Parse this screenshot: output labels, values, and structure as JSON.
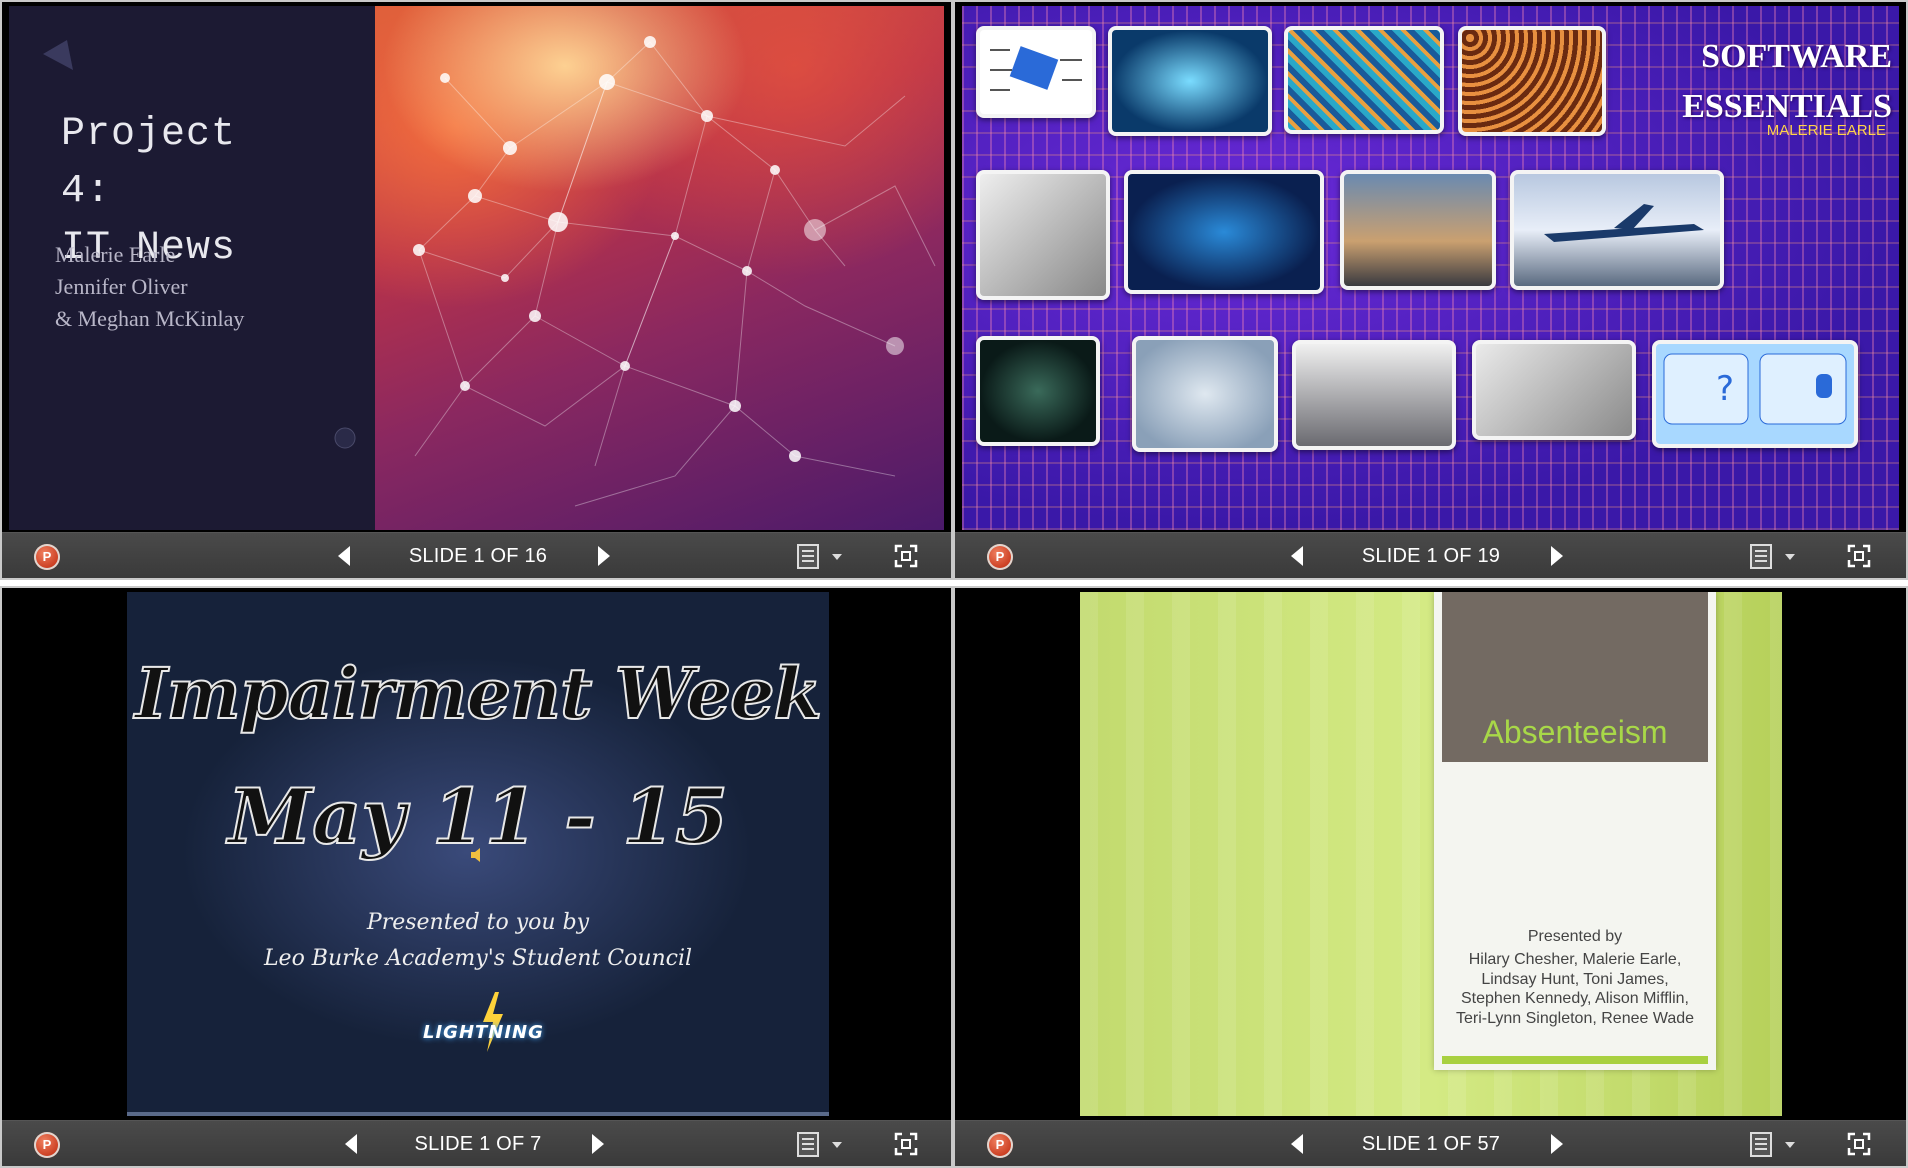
{
  "colors": {
    "toolbar_bg": "#3f3f3f",
    "ppt_icon": "#c8391d",
    "viewer_border": "#c9c9c9"
  },
  "viewers": [
    {
      "counter": "SLIDE 1 OF 16",
      "slide": {
        "title": "Project\n4:\nIT News",
        "authors": [
          "Malerie Earle",
          "Jennifer Oliver",
          "& Meghan McKinlay"
        ]
      }
    },
    {
      "counter": "SLIDE 1 OF 19",
      "slide": {
        "title_line1": "SOFTWARE",
        "title_line2": "ESSENTIALS",
        "subtitle": "MALERIE EARLE",
        "images": [
          "chip",
          "processor",
          "circuit-board",
          "memory-array",
          "telephone",
          "cloud-network",
          "rocket-launch",
          "airplane",
          "hacker",
          "ai-brain",
          "laptop-monitors",
          "typing-laptop",
          "flowchart-database"
        ]
      }
    },
    {
      "counter": "SLIDE 1 OF 7",
      "slide": {
        "title_line1": "Impairment Week",
        "title_line2": "May 11 - 15",
        "presented_line1": "Presented to you by",
        "presented_line2": "Leo Burke Academy's Student Council",
        "logo_text": "LIGHTNING"
      }
    },
    {
      "counter": "SLIDE 1 OF 57",
      "slide": {
        "title": "Absenteeism",
        "presented_by": "Presented by",
        "names": "Hilary Chesher, Malerie Earle, Lindsay Hunt, Toni James, Stephen Kennedy, Alison Mifflin, Teri-Lynn Singleton, Renee Wade"
      }
    }
  ],
  "icons": {
    "app": "powerpoint-icon",
    "prev": "triangle-left-icon",
    "next": "triangle-right-icon",
    "notes": "notes-icon",
    "dropdown": "chevron-down-icon",
    "fullscreen": "fullscreen-icon"
  }
}
